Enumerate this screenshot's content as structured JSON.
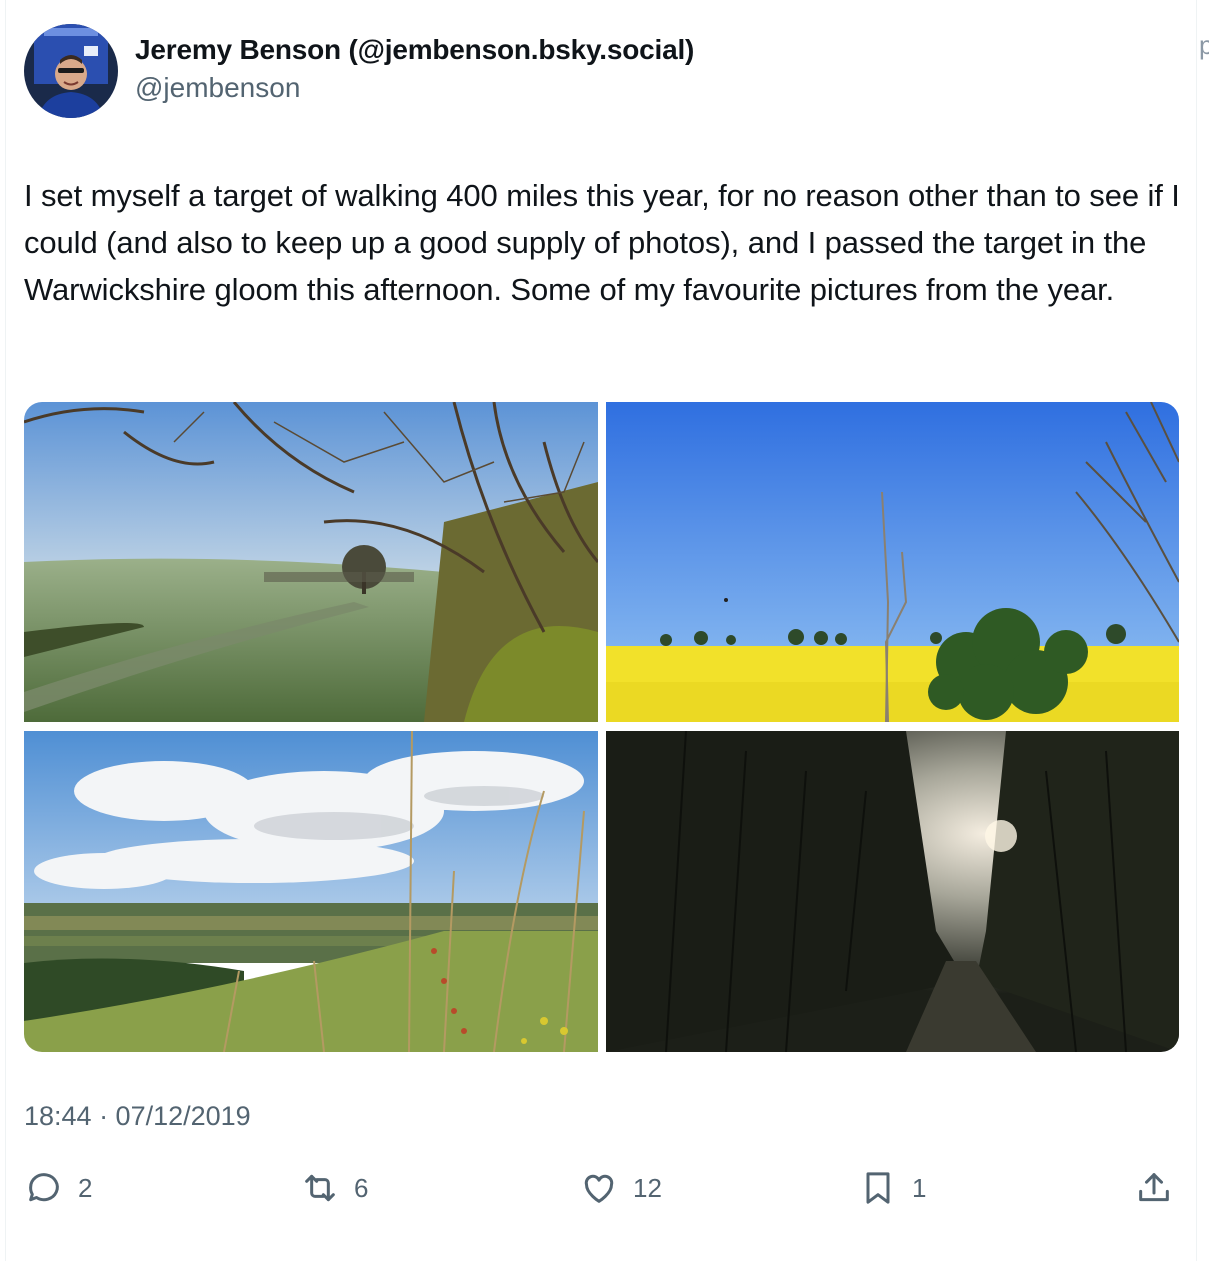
{
  "post": {
    "author_name": "Jeremy Benson (@jembenson.bsky.social)",
    "author_handle": "@jembenson",
    "text": "I set myself a target of walking 400 miles this year, for no reason other than to see if I could (and also to keep up a good supply of photos), and I passed the target in the Warwickshire gloom this afternoon. Some of my favourite pictures from the year.",
    "timestamp": "18:44 · 07/12/2019"
  },
  "actions": {
    "replies": "2",
    "reposts": "6",
    "likes": "12",
    "bookmarks": "1"
  },
  "icons": {
    "reply": "speech-bubble-icon",
    "repost": "repost-arrows-icon",
    "like": "heart-icon",
    "bookmark": "bookmark-icon",
    "share": "share-upload-icon"
  },
  "colors": {
    "text": "#0f1419",
    "secondary": "#536471",
    "rape_field": "#f2e12a",
    "sky": "#2f6fe0"
  }
}
